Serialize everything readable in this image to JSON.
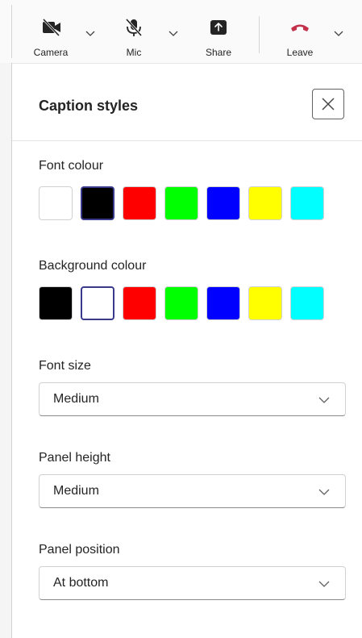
{
  "toolbar": {
    "camera": {
      "label": "Camera",
      "icon": "camera-off-icon"
    },
    "mic": {
      "label": "Mic",
      "icon": "mic-off-icon"
    },
    "share": {
      "label": "Share",
      "icon": "share-tray-icon"
    },
    "leave": {
      "label": "Leave",
      "icon": "hang-up-icon",
      "color": "#c4314b"
    }
  },
  "panel": {
    "title": "Caption styles",
    "close_icon": "close-icon",
    "font_colour": {
      "label": "Font colour",
      "swatches": [
        "#ffffff",
        "#000000",
        "#ff0000",
        "#00ff00",
        "#0000ff",
        "#ffff00",
        "#00ffff"
      ],
      "selected_index": 1
    },
    "background_colour": {
      "label": "Background colour",
      "swatches": [
        "#000000",
        "#ffffff",
        "#ff0000",
        "#00ff00",
        "#0000ff",
        "#ffff00",
        "#00ffff"
      ],
      "selected_index": 1
    },
    "font_size": {
      "label": "Font size",
      "value": "Medium"
    },
    "panel_height": {
      "label": "Panel height",
      "value": "Medium"
    },
    "panel_position": {
      "label": "Panel position",
      "value": "At bottom"
    }
  }
}
